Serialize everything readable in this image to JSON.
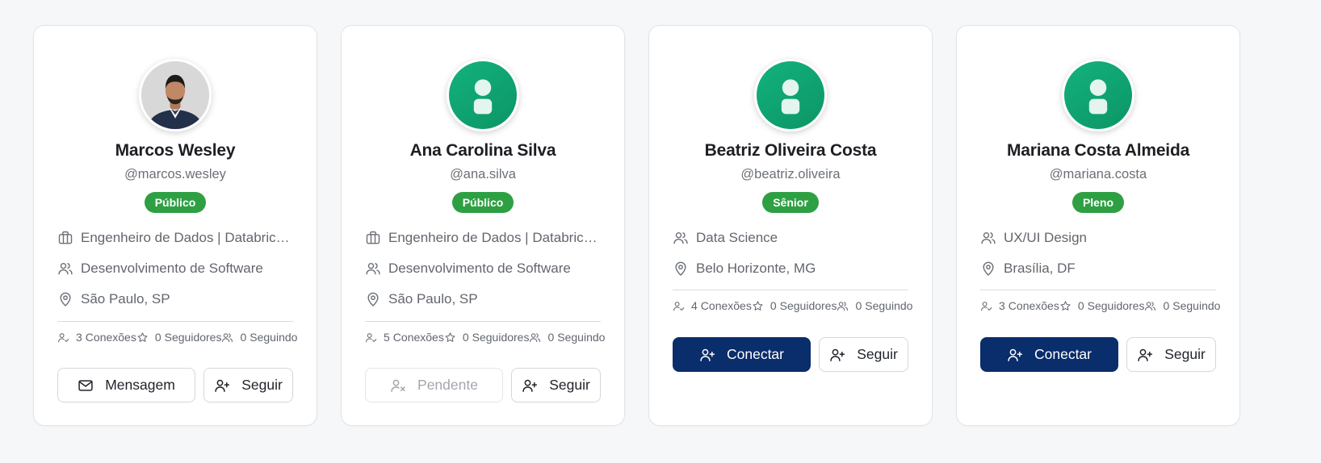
{
  "colors": {
    "page_bg": "#f6f7f9",
    "badge_green": "#2ea043",
    "primary_navy": "#0a2d6b",
    "avatar_green": "#13b27e"
  },
  "cards": [
    {
      "name": "Marcos Wesley",
      "username": "@marcos.wesley",
      "badge": "Público",
      "avatar": "photo",
      "info": [
        {
          "icon": "briefcase-icon",
          "text": "Engenheiro de Dados | Databricks Certified"
        },
        {
          "icon": "users-icon",
          "text": "Desenvolvimento de Software"
        },
        {
          "icon": "map-pin-icon",
          "text": "São Paulo, SP"
        }
      ],
      "stats": {
        "connections_value": "3",
        "connections_label": "Conexões",
        "followers_value": "0",
        "followers_label": "Seguidores",
        "following_value": "0",
        "following_label": "Seguindo"
      },
      "primary_action": {
        "label": "Mensagem",
        "icon": "mail-icon",
        "state": "outline"
      },
      "secondary_action": {
        "label": "Seguir",
        "icon": "user-plus-icon"
      }
    },
    {
      "name": "Ana Carolina Silva",
      "username": "@ana.silva",
      "badge": "Público",
      "avatar": "placeholder",
      "info": [
        {
          "icon": "briefcase-icon",
          "text": "Engenheiro de Dados | Databricks Certified"
        },
        {
          "icon": "users-icon",
          "text": "Desenvolvimento de Software"
        },
        {
          "icon": "map-pin-icon",
          "text": "São Paulo, SP"
        }
      ],
      "stats": {
        "connections_value": "5",
        "connections_label": "Conexões",
        "followers_value": "0",
        "followers_label": "Seguidores",
        "following_value": "0",
        "following_label": "Seguindo"
      },
      "primary_action": {
        "label": "Pendente",
        "icon": "user-x-icon",
        "state": "disabled"
      },
      "secondary_action": {
        "label": "Seguir",
        "icon": "user-plus-icon"
      }
    },
    {
      "name": "Beatriz Oliveira Costa",
      "username": "@beatriz.oliveira",
      "badge": "Sênior",
      "avatar": "placeholder",
      "info": [
        {
          "icon": "users-icon",
          "text": "Data Science"
        },
        {
          "icon": "map-pin-icon",
          "text": "Belo Horizonte, MG"
        }
      ],
      "stats": {
        "connections_value": "4",
        "connections_label": "Conexões",
        "followers_value": "0",
        "followers_label": "Seguidores",
        "following_value": "0",
        "following_label": "Seguindo"
      },
      "primary_action": {
        "label": "Conectar",
        "icon": "user-plus-icon",
        "state": "primary"
      },
      "secondary_action": {
        "label": "Seguir",
        "icon": "user-plus-icon"
      }
    },
    {
      "name": "Mariana Costa Almeida",
      "username": "@mariana.costa",
      "badge": "Pleno",
      "avatar": "placeholder",
      "info": [
        {
          "icon": "users-icon",
          "text": "UX/UI Design"
        },
        {
          "icon": "map-pin-icon",
          "text": "Brasília, DF"
        }
      ],
      "stats": {
        "connections_value": "3",
        "connections_label": "Conexões",
        "followers_value": "0",
        "followers_label": "Seguidores",
        "following_value": "0",
        "following_label": "Seguindo"
      },
      "primary_action": {
        "label": "Conectar",
        "icon": "user-plus-icon",
        "state": "primary"
      },
      "secondary_action": {
        "label": "Seguir",
        "icon": "user-plus-icon"
      }
    }
  ]
}
